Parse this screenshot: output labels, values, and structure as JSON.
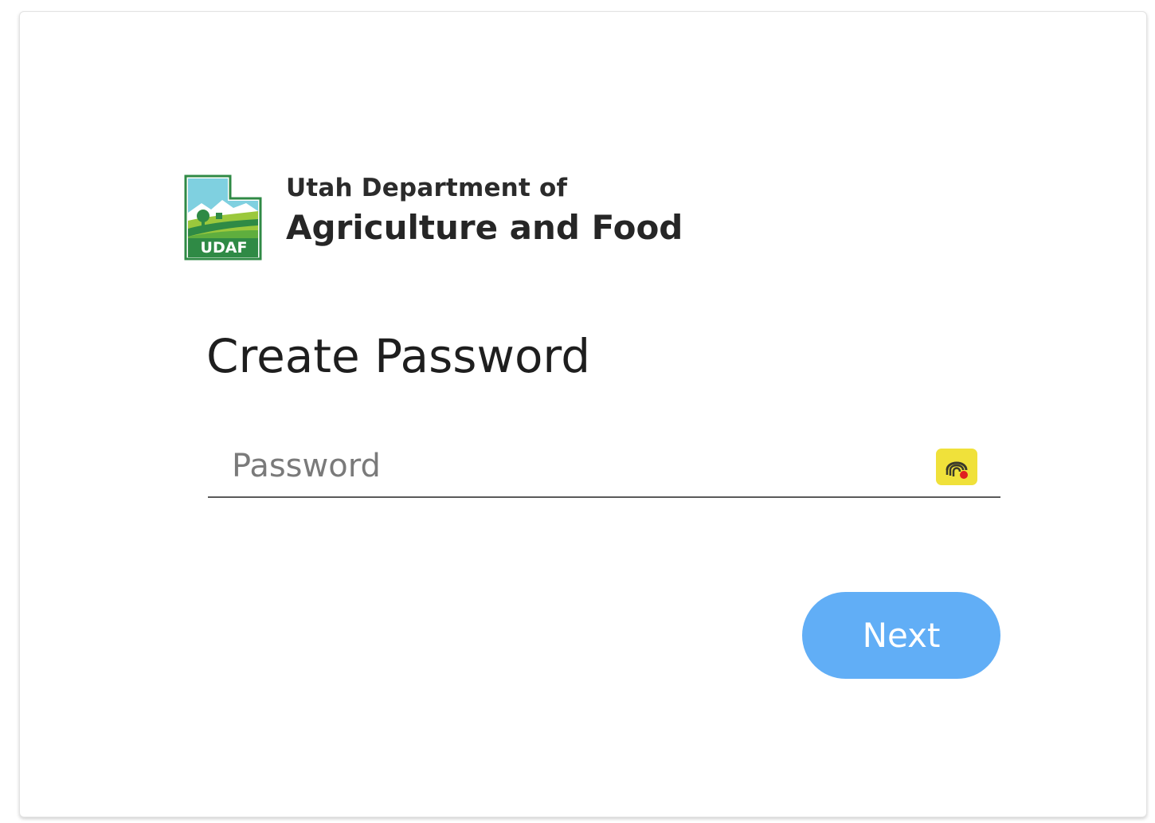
{
  "org": {
    "line1": "Utah Department of",
    "line2": "Agriculture and Food",
    "logo_text": "UDAF"
  },
  "heading": "Create Password",
  "password_field": {
    "placeholder": "Password",
    "value": ""
  },
  "password_manager_icon": "password-manager-icon",
  "next_button": {
    "label": "Next"
  },
  "colors": {
    "button": "#61aef6",
    "logo_green": "#2f8a45",
    "logo_sky": "#7fd0e0",
    "pw_manager_bg": "#f0e13a"
  }
}
